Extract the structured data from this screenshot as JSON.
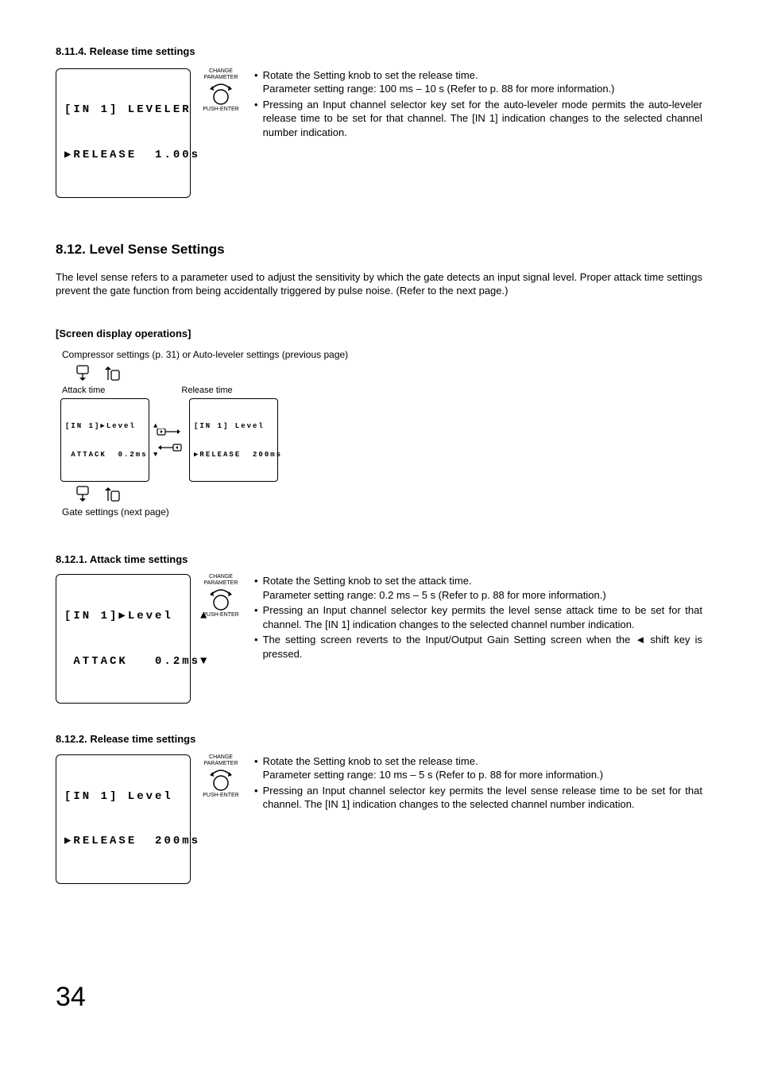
{
  "s814": {
    "heading": "8.11.4. Release time settings",
    "lcd_l1": "[IN 1] LEVELER",
    "lcd_l2": "▶RELEASE  1.00s",
    "knob_top": "CHANGE",
    "knob_mid": "PARAMETER",
    "knob_bot": "PUSH-ENTER",
    "b1": "Rotate the Setting knob to set the release time.",
    "b1_sub_lead": "Parameter setting range: ",
    "b1_sub_rest": "100 ms – 10 s (Refer to p. 88 for more information.)",
    "b2": "Pressing an Input channel selector key set for the auto-leveler mode permits the auto-leveler release time to be set for that channel. The [IN 1] indication changes to the selected channel number indication."
  },
  "s812": {
    "heading": "8.12. Level Sense Settings",
    "intro": "The level sense refers to a parameter used to adjust the sensitivity by which the gate detects an input signal level. Proper attack time settings prevent the gate function from being accidentally triggered by pulse noise. (Refer to the next page.)",
    "sdo": "[Screen display operations]",
    "top_note": "Compressor settings (p. 31) or Auto-leveler settings (previous page)",
    "lbl_attack": "Attack time",
    "lbl_release": "Release time",
    "attack_l1": "[IN 1]▶Level   ▲",
    "attack_l2": " ATTACK  0.2ms ▼",
    "release_l1": "[IN 1] Level",
    "release_l2": "▶RELEASE  200ms",
    "bottom_note": "Gate settings (next page)"
  },
  "s8121": {
    "heading": "8.12.1. Attack time settings",
    "lcd_l1": "[IN 1]▶Level   ▲",
    "lcd_l2": " ATTACK   0.2ms▼",
    "b1": "Rotate the Setting knob to set the attack time.",
    "b1_sub_lead": "Parameter setting range: ",
    "b1_sub_rest": "0.2 ms – 5 s (Refer to p. 88 for more information.)",
    "b2": "Pressing an Input channel selector key permits the level sense attack time to be set for that channel. The [IN 1] indication changes to the selected channel number indication.",
    "b3_a": "The setting screen reverts to the Input/Output Gain Setting screen when the ",
    "b3_b": " shift key is pressed."
  },
  "s8122": {
    "heading": "8.12.2. Release time settings",
    "lcd_l1": "[IN 1] Level",
    "lcd_l2": "▶RELEASE  200ms",
    "b1": "Rotate the Setting knob to set the release time.",
    "b1_sub_lead": "Parameter setting range: ",
    "b1_sub_rest": "10 ms – 5 s (Refer to p. 88 for more information.)",
    "b2": "Pressing an Input channel selector key permits the level sense release time to be set for that channel. The [IN 1] indication changes to the selected channel number indication."
  },
  "page_number": "34"
}
